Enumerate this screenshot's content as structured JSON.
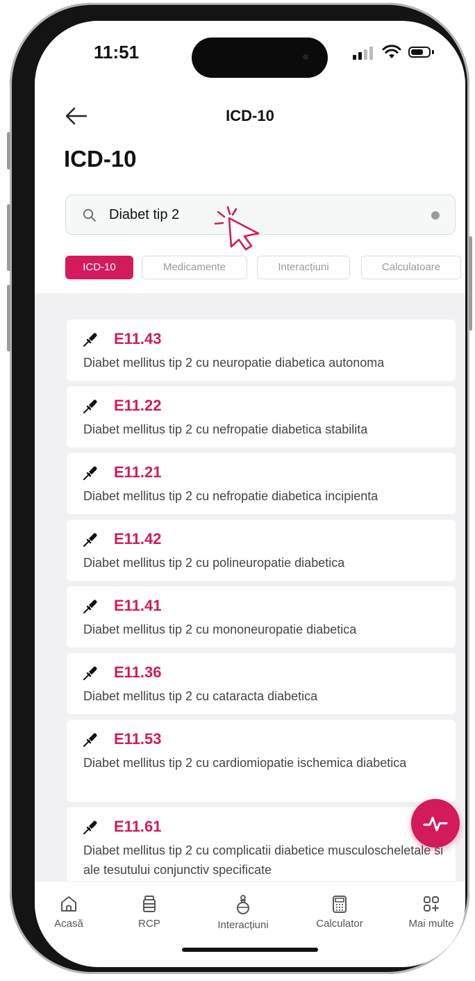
{
  "status_bar": {
    "time": "11:51"
  },
  "header": {
    "nav_title": "ICD-10",
    "page_title": "ICD-10"
  },
  "search": {
    "value": "Diabet tip 2"
  },
  "filters": [
    {
      "label": "ICD-10",
      "active": true
    },
    {
      "label": "Medicamente",
      "active": false
    },
    {
      "label": "Interacțiuni",
      "active": false
    },
    {
      "label": "Calculatoare",
      "active": false
    }
  ],
  "results": [
    {
      "code": "E11.43",
      "description": "Diabet mellitus tip 2 cu neuropatie diabetica autonoma"
    },
    {
      "code": "E11.22",
      "description": "Diabet mellitus tip 2 cu nefropatie diabetica stabilita"
    },
    {
      "code": "E11.21",
      "description": "Diabet mellitus tip 2 cu nefropatie diabetica incipienta"
    },
    {
      "code": "E11.42",
      "description": "Diabet mellitus tip 2 cu polineuropatie diabetica"
    },
    {
      "code": "E11.41",
      "description": "Diabet mellitus tip 2 cu mononeuropatie diabetica"
    },
    {
      "code": "E11.36",
      "description": "Diabet mellitus tip 2 cu cataracta diabetica"
    },
    {
      "code": "E11.53",
      "description": "Diabet mellitus tip 2 cu cardiomiopatie ischemica diabetica"
    },
    {
      "code": "E11.61",
      "description": "Diabet mellitus tip 2 cu complicatii diabetice musculoscheletale si ale tesutului conjunctiv specificate"
    }
  ],
  "tab_bar": [
    {
      "label": "Acasă",
      "icon": "home-icon"
    },
    {
      "label": "RCP",
      "icon": "document-stack-icon"
    },
    {
      "label": "Interacțiuni",
      "icon": "flask-icon"
    },
    {
      "label": "Calculator",
      "icon": "calculator-icon"
    },
    {
      "label": "Mai multe",
      "icon": "grid-plus-icon"
    }
  ],
  "colors": {
    "accent": "#d21a5c",
    "code_text": "#cf1c5c"
  }
}
